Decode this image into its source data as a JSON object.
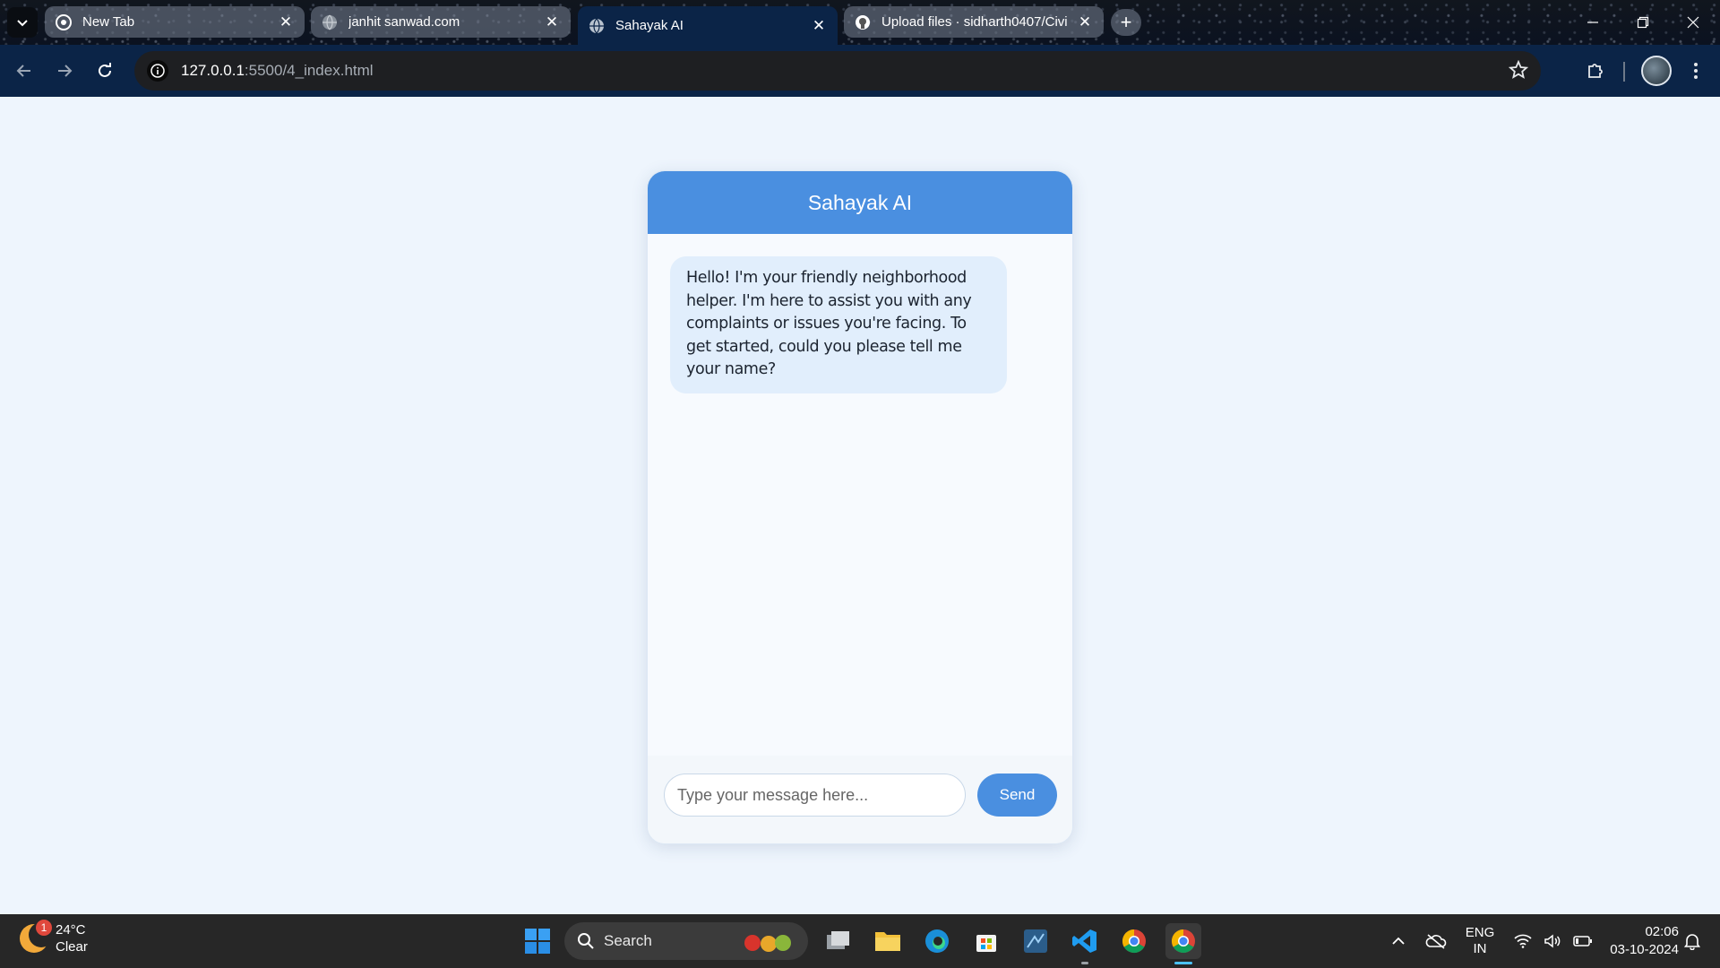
{
  "browser": {
    "tabs": [
      {
        "title": "New Tab",
        "active": false
      },
      {
        "title": "janhit sanwad.com",
        "active": false
      },
      {
        "title": "Sahayak AI",
        "active": true
      },
      {
        "title": "Upload files · sidharth0407/Civi",
        "active": false
      }
    ],
    "url_host": "127.0.0.1",
    "url_path": ":5500/4_index.html"
  },
  "chat": {
    "title": "Sahayak AI",
    "messages": [
      {
        "sender": "bot",
        "text": "Hello! I'm your friendly neighborhood helper. I'm here to assist you with any complaints or issues you're facing. To get started, could you please tell me your name?"
      }
    ],
    "input_placeholder": "Type your message here...",
    "send_label": "Send"
  },
  "taskbar": {
    "weather_temp": "24°C",
    "weather_desc": "Clear",
    "weather_badge": "1",
    "search_label": "Search",
    "lang_top": "ENG",
    "lang_bottom": "IN",
    "time": "02:06",
    "date": "03-10-2024"
  },
  "colors": {
    "accent": "#4a8fe0",
    "bubble": "#e1eefc",
    "page_bg": "#eef5fd"
  }
}
